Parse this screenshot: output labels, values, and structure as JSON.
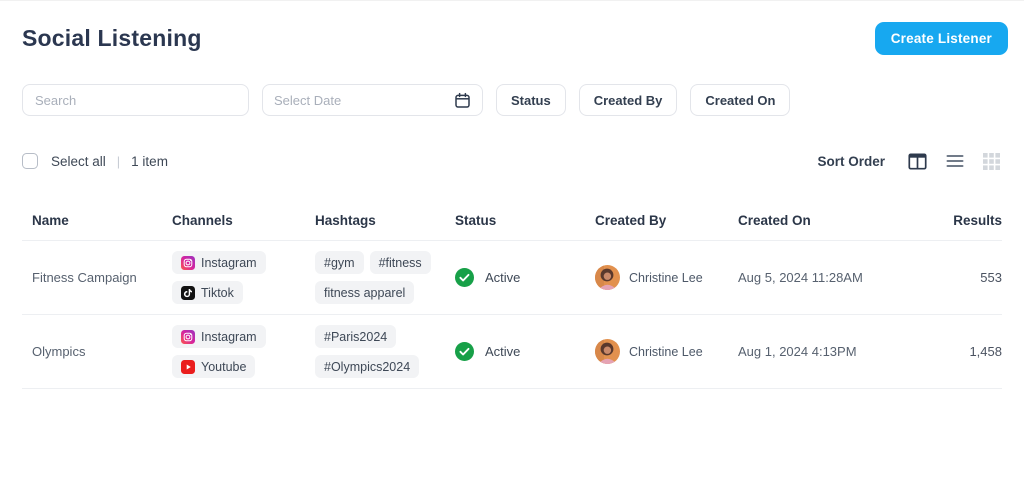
{
  "page": {
    "title": "Social Listening",
    "create_button_label": "Create Listener"
  },
  "filters": {
    "search_placeholder": "Search",
    "date_placeholder": "Select Date",
    "status_button": "Status",
    "created_by_button": "Created By",
    "created_on_button": "Created On"
  },
  "toolbar": {
    "select_all_label": "Select all",
    "divider": "|",
    "item_count": "1 item",
    "sort_order_label": "Sort Order",
    "view_icons": [
      "columns-view-icon",
      "list-view-icon",
      "grid-view-icon"
    ]
  },
  "table": {
    "headers": [
      "Name",
      "Channels",
      "Hashtags",
      "Status",
      "Created By",
      "Created On",
      "Results"
    ],
    "rows": [
      {
        "name": "Fitness Campaign",
        "channels": [
          {
            "label": "Instagram",
            "icon": "instagram"
          },
          {
            "label": "Tiktok",
            "icon": "tiktok"
          }
        ],
        "hashtags": [
          "#gym",
          "#fitness",
          "fitness apparel"
        ],
        "status": "Active",
        "created_by": "Christine Lee",
        "created_on": "Aug 5, 2024 11:28AM",
        "results": "553"
      },
      {
        "name": "Olympics",
        "channels": [
          {
            "label": "Instagram",
            "icon": "instagram"
          },
          {
            "label": "Youtube",
            "icon": "youtube"
          }
        ],
        "hashtags": [
          "#Paris2024",
          "#Olympics2024"
        ],
        "status": "Active",
        "created_by": "Christine Lee",
        "created_on": "Aug 1, 2024 4:13PM",
        "results": "1,458"
      }
    ]
  },
  "colors": {
    "accent_blue": "#17a8f0",
    "status_green": "#17a048",
    "title_navy": "#2b3750",
    "chip_background": "#f2f3f5",
    "youtube_red": "#ea1d1d",
    "tiktok_black": "#121212"
  }
}
